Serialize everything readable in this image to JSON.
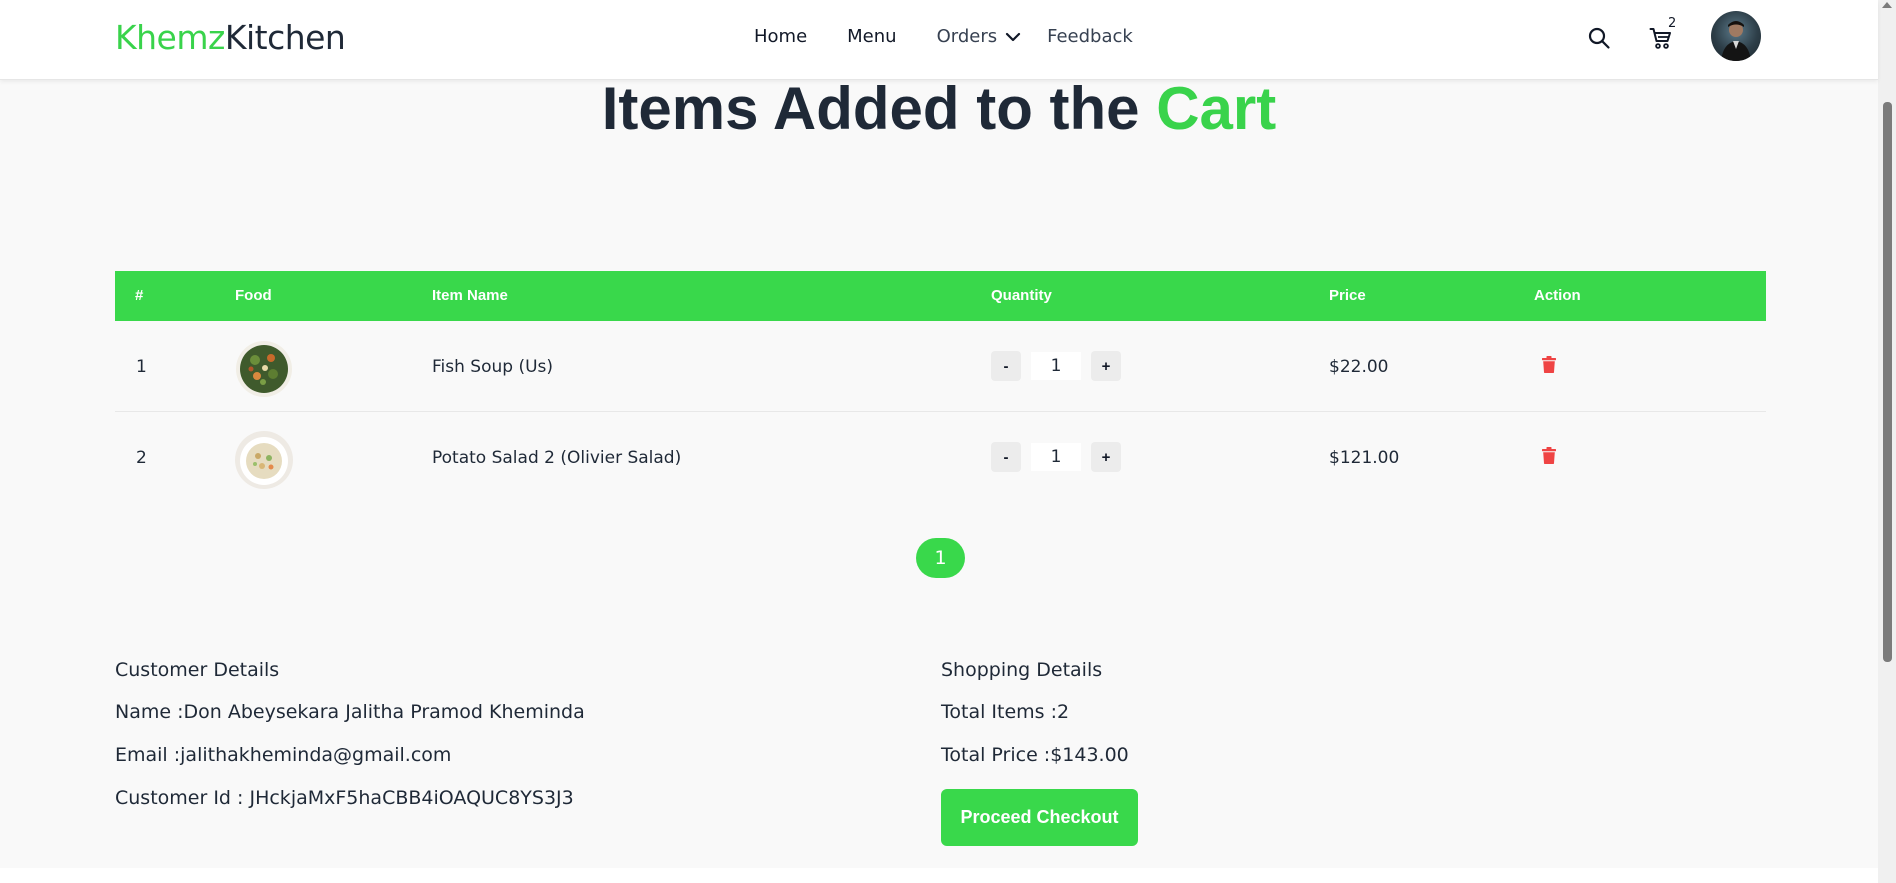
{
  "colors": {
    "accent": "#39d84b",
    "text": "#1f2937",
    "delete": "#ef4444"
  },
  "header": {
    "brand_part1": "Khemz",
    "brand_part2": "Kitchen",
    "nav": {
      "home": "Home",
      "menu": "Menu",
      "orders": "Orders",
      "feedback": "Feedback"
    },
    "icons": {
      "search": "search-icon",
      "cart": "cart-icon",
      "dropdown": "chevron-down-icon"
    },
    "cart_count": "2"
  },
  "title": {
    "part1": "Items Added to the ",
    "part2": "Cart"
  },
  "table": {
    "headers": {
      "num": "#",
      "food": "Food",
      "name": "Item Name",
      "quantity": "Quantity",
      "price": "Price",
      "action": "Action"
    },
    "rows": [
      {
        "num": "1",
        "name": "Fish Soup (Us)",
        "quantity": "1",
        "price": "$22.00",
        "minus": "-",
        "plus": "+"
      },
      {
        "num": "2",
        "name": "Potato Salad 2 (Olivier Salad)",
        "quantity": "1",
        "price": "$121.00",
        "minus": "-",
        "plus": "+"
      }
    ]
  },
  "pagination": {
    "current": "1"
  },
  "customer": {
    "heading": "Customer Details",
    "name": "Name :Don Abeysekara Jalitha Pramod Kheminda",
    "email": "Email :jalithakheminda@gmail.com",
    "id": "Customer Id : JHckjaMxF5haCBB4iOAQUC8YS3J3"
  },
  "shopping": {
    "heading": "Shopping Details",
    "total_items": "Total Items :2",
    "total_price": "Total Price :$143.00",
    "checkout_label": "Proceed Checkout"
  }
}
